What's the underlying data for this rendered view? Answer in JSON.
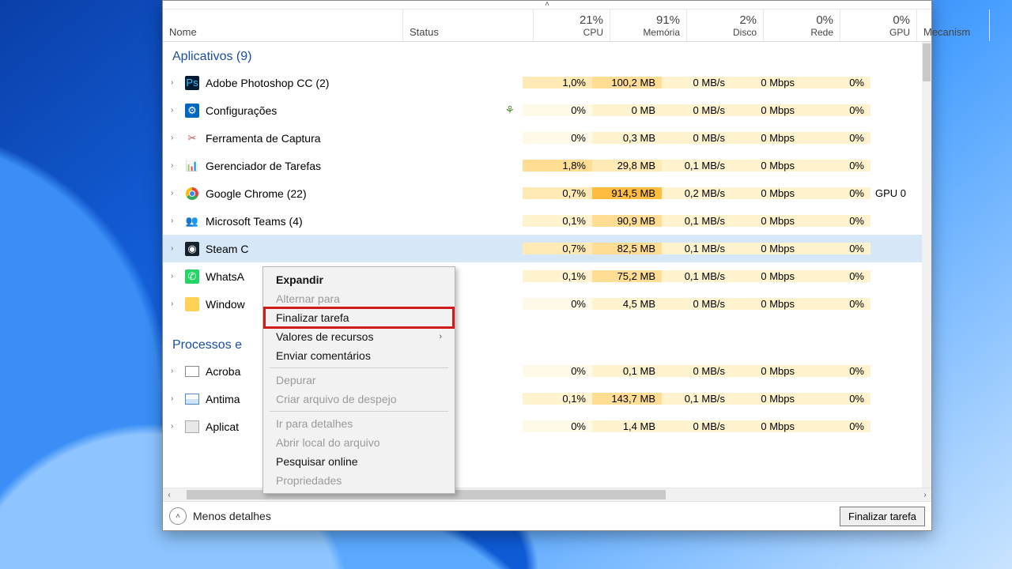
{
  "header": {
    "name": "Nome",
    "status": "Status",
    "cols": [
      {
        "pct": "21%",
        "lbl": "CPU"
      },
      {
        "pct": "91%",
        "lbl": "Memória"
      },
      {
        "pct": "2%",
        "lbl": "Disco"
      },
      {
        "pct": "0%",
        "lbl": "Rede"
      },
      {
        "pct": "0%",
        "lbl": "GPU"
      }
    ],
    "gpu_engine": "Mecanism"
  },
  "groups": {
    "apps": "Aplicativos (9)",
    "bg": "Processos e"
  },
  "rows": {
    "ps": {
      "name": "Adobe Photoshop CC (2)",
      "cpu": "1,0%",
      "mem": "100,2 MB",
      "disk": "0 MB/s",
      "net": "0 Mbps",
      "gpu": "0%",
      "gpue": ""
    },
    "cfg": {
      "name": "Configurações",
      "cpu": "0%",
      "mem": "0 MB",
      "disk": "0 MB/s",
      "net": "0 Mbps",
      "gpu": "0%",
      "gpue": ""
    },
    "snip": {
      "name": "Ferramenta de Captura",
      "cpu": "0%",
      "mem": "0,3 MB",
      "disk": "0 MB/s",
      "net": "0 Mbps",
      "gpu": "0%",
      "gpue": ""
    },
    "tm": {
      "name": "Gerenciador de Tarefas",
      "cpu": "1,8%",
      "mem": "29,8 MB",
      "disk": "0,1 MB/s",
      "net": "0 Mbps",
      "gpu": "0%",
      "gpue": ""
    },
    "ch": {
      "name": "Google Chrome (22)",
      "cpu": "0,7%",
      "mem": "914,5 MB",
      "disk": "0,2 MB/s",
      "net": "0 Mbps",
      "gpu": "0%",
      "gpue": "GPU 0"
    },
    "tms": {
      "name": "Microsoft Teams (4)",
      "cpu": "0,1%",
      "mem": "90,9 MB",
      "disk": "0,1 MB/s",
      "net": "0 Mbps",
      "gpu": "0%",
      "gpue": ""
    },
    "st": {
      "name": "Steam C",
      "cpu": "0,7%",
      "mem": "82,5 MB",
      "disk": "0,1 MB/s",
      "net": "0 Mbps",
      "gpu": "0%",
      "gpue": ""
    },
    "wa": {
      "name": "WhatsA",
      "cpu": "0,1%",
      "mem": "75,2 MB",
      "disk": "0,1 MB/s",
      "net": "0 Mbps",
      "gpu": "0%",
      "gpue": ""
    },
    "we": {
      "name": "Window",
      "cpu": "0%",
      "mem": "4,5 MB",
      "disk": "0 MB/s",
      "net": "0 Mbps",
      "gpu": "0%",
      "gpue": ""
    },
    "ac": {
      "name": "Acroba",
      "cpu": "0%",
      "mem": "0,1 MB",
      "disk": "0 MB/s",
      "net": "0 Mbps",
      "gpu": "0%",
      "gpue": ""
    },
    "am": {
      "name": "Antima",
      "cpu": "0,1%",
      "mem": "143,7 MB",
      "disk": "0,1 MB/s",
      "net": "0 Mbps",
      "gpu": "0%",
      "gpue": ""
    },
    "ap": {
      "name": "Aplicat",
      "cpu": "0%",
      "mem": "1,4 MB",
      "disk": "0 MB/s",
      "net": "0 Mbps",
      "gpu": "0%",
      "gpue": ""
    }
  },
  "context_menu": {
    "expand": "Expandir",
    "switch": "Alternar para",
    "end": "Finalizar tarefa",
    "values": "Valores de recursos",
    "feedback": "Enviar comentários",
    "debug": "Depurar",
    "dump": "Criar arquivo de despejo",
    "details": "Ir para detalhes",
    "open": "Abrir local do arquivo",
    "search": "Pesquisar online",
    "props": "Propriedades"
  },
  "footer": {
    "fewer": "Menos detalhes",
    "end": "Finalizar tarefa"
  }
}
